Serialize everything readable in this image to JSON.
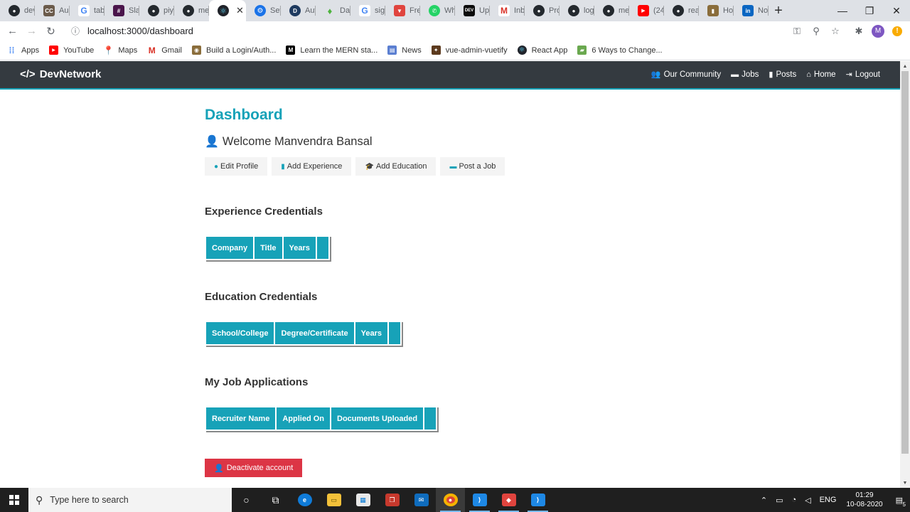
{
  "browser": {
    "tabs": [
      {
        "title": "dev",
        "icon": "github-icon",
        "color": "#24292e"
      },
      {
        "title": "Auc",
        "icon": "cc-icon",
        "color": "#6b5b4b"
      },
      {
        "title": "tabl",
        "icon": "google-icon",
        "color": "#4285f4"
      },
      {
        "title": "Slac",
        "icon": "slack-icon",
        "color": "#4a154b"
      },
      {
        "title": "piyu",
        "icon": "github-icon",
        "color": "#24292e"
      },
      {
        "title": "me",
        "icon": "github-icon",
        "color": "#24292e"
      },
      {
        "title": "",
        "icon": "react-icon",
        "color": "#61dafb",
        "active": true
      },
      {
        "title": "Sett",
        "icon": "settings-icon",
        "color": "#1a73e8"
      },
      {
        "title": "Aut",
        "icon": "d-icon",
        "color": "#1e3a5f"
      },
      {
        "title": "Dat",
        "icon": "mongodb-icon",
        "color": "#4db33d"
      },
      {
        "title": "sign",
        "icon": "google-icon",
        "color": "#4285f4"
      },
      {
        "title": "Free",
        "icon": "shield-icon",
        "color": "#e0443e"
      },
      {
        "title": "Wh",
        "icon": "whatsapp-icon",
        "color": "#25d366"
      },
      {
        "title": "Upl",
        "icon": "dev-icon",
        "color": "#0a0a0a"
      },
      {
        "title": "Inb",
        "icon": "gmail-icon",
        "color": "#d93025"
      },
      {
        "title": "Pro",
        "icon": "github-icon",
        "color": "#24292e"
      },
      {
        "title": "log",
        "icon": "github-icon",
        "color": "#24292e"
      },
      {
        "title": "me",
        "icon": "github-icon",
        "color": "#24292e"
      },
      {
        "title": "(24",
        "icon": "youtube-icon",
        "color": "#ff0000"
      },
      {
        "title": "rea",
        "icon": "github-icon",
        "color": "#24292e"
      },
      {
        "title": "Hov",
        "icon": "bookmark-icon",
        "color": "#8a6d3b"
      },
      {
        "title": "Not",
        "icon": "linkedin-icon",
        "color": "#0a66c2"
      }
    ],
    "active_tab_close": "✕",
    "new_tab": "+",
    "address": "localhost:3000/dashboard",
    "profile_initial": "M",
    "bookmarks": [
      {
        "label": "Apps",
        "icon": "apps-icon",
        "color": "#4285f4"
      },
      {
        "label": "YouTube",
        "icon": "youtube-icon",
        "color": "#ff0000"
      },
      {
        "label": "Maps",
        "icon": "maps-icon",
        "color": "#34a853"
      },
      {
        "label": "Gmail",
        "icon": "gmail-icon",
        "color": "#d93025"
      },
      {
        "label": "Build a Login/Auth...",
        "icon": "owl-icon",
        "color": "#8a6d3b"
      },
      {
        "label": "Learn the MERN sta...",
        "icon": "medium-icon",
        "color": "#000000"
      },
      {
        "label": "News",
        "icon": "news-icon",
        "color": "#5b7fd1"
      },
      {
        "label": "vue-admin-vuetify",
        "icon": "vue-icon",
        "color": "#5c3a1e"
      },
      {
        "label": "React App",
        "icon": "react-icon",
        "color": "#61dafb"
      },
      {
        "label": "6 Ways to Change...",
        "icon": "bookmark-icon",
        "color": "#6aa84f"
      }
    ]
  },
  "navbar": {
    "brand": "DevNetwork",
    "links": [
      {
        "label": "Our Community",
        "icon": "users-icon"
      },
      {
        "label": "Jobs",
        "icon": "briefcase-icon"
      },
      {
        "label": "Posts",
        "icon": "clipboard-icon"
      },
      {
        "label": "Home",
        "icon": "home-icon"
      },
      {
        "label": "Logout",
        "icon": "sign-out-icon"
      }
    ]
  },
  "dashboard": {
    "title": "Dashboard",
    "welcome": "Welcome Manvendra Bansal",
    "actions": [
      {
        "label": "Edit Profile",
        "icon": "user-circle-icon"
      },
      {
        "label": "Add Experience",
        "icon": "id-badge-icon"
      },
      {
        "label": "Add Education",
        "icon": "graduation-cap-icon"
      },
      {
        "label": "Post a Job",
        "icon": "briefcase-icon"
      }
    ],
    "experience": {
      "heading": "Experience Credentials",
      "columns": [
        "Company",
        "Title",
        "Years",
        ""
      ]
    },
    "education": {
      "heading": "Education Credentials",
      "columns": [
        "School/College",
        "Degree/Certificate",
        "Years",
        ""
      ]
    },
    "applications": {
      "heading": "My Job Applications",
      "columns": [
        "Recruiter Name",
        "Applied On",
        "Documents Uploaded",
        ""
      ]
    },
    "deactivate": "Deactivate account"
  },
  "taskbar": {
    "search_placeholder": "Type here to search",
    "language": "ENG",
    "time": "01:29",
    "date": "10-08-2020",
    "notifications": "5"
  },
  "colors": {
    "accent": "#17a2b8",
    "navbar": "#343a40",
    "danger": "#dc3545"
  }
}
